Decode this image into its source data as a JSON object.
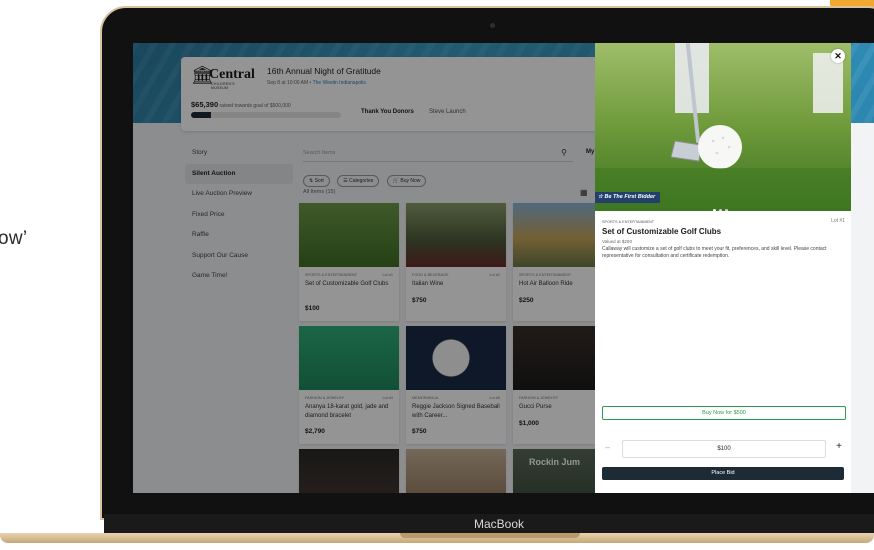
{
  "marketing": {
    "side_text": "ow’"
  },
  "device": {
    "label": "MacBook"
  },
  "event": {
    "org_name": "Central",
    "org_sub": "CHILDREN'S MUSEUM",
    "title": "16th Annual Night of Gratitude",
    "date": "Sep 8 at 10:00 AM • ",
    "venue": "The Westin Indianapolis",
    "raised_amount": "$65,390",
    "raised_text": "raised towards goal of $500,000",
    "progress_fraction": 0.13,
    "tabs": [
      "Thank You Donors",
      "Steve Launch"
    ]
  },
  "sidebar": {
    "items": [
      {
        "label": "Story"
      },
      {
        "label": "Silent Auction",
        "active": true
      },
      {
        "label": "Live Auction Preview"
      },
      {
        "label": "Fixed Price"
      },
      {
        "label": "Raffle"
      },
      {
        "label": "Support Our Cause"
      },
      {
        "label": "Game Time!"
      }
    ]
  },
  "toolbar": {
    "search_placeholder": "Search Items",
    "my_bids": "My",
    "chips": [
      "Sort",
      "Categories",
      "Buy Now"
    ],
    "all_items": "All Items (15)"
  },
  "items": [
    {
      "category": "SPORTS & ENTERTAINMENT",
      "lot": "Lot #1",
      "name": "Set of Customizable Golf Clubs",
      "price": "$100"
    },
    {
      "category": "FOOD & BEVERAGE",
      "lot": "Lot #2",
      "name": "Italian Wine",
      "price": "$750"
    },
    {
      "category": "SPORTS & ENTERTAINMENT",
      "lot": "",
      "name": "Hot Air Balloon Ride",
      "price": "$250"
    },
    {
      "category": "FASHION & JEWELRY",
      "lot": "Lot #4",
      "name": "Ananya 18-karat gold, jade and diamond bracelet",
      "price": "$2,790"
    },
    {
      "category": "MEMORABILIA",
      "lot": "Lot #5",
      "name": "Reggie Jackson Signed Baseball with Career...",
      "price": "$750"
    },
    {
      "category": "FASHION & JEWELRY",
      "lot": "",
      "name": "Gucci Purse",
      "price": "$1,000"
    },
    {
      "category": "",
      "lot": "",
      "name": "",
      "price": ""
    },
    {
      "category": "",
      "lot": "",
      "name": "",
      "price": ""
    },
    {
      "category": "",
      "lot": "Rockin Jum",
      "name": "",
      "price": ""
    }
  ],
  "modal": {
    "badge": "Be The First Bidder",
    "category": "SPORTS & ENTERTAINMENT",
    "lot": "Lot #1",
    "title": "Set of Customizable Golf Clubs",
    "valued": "Valued at $200",
    "description": "Callaway will customize a set of golf clubs to meet your fit, preferences, and skill level. Please contact representative for consultation and certificate redemption.",
    "buy_now": "Buy Now for $500",
    "bid_amount": "$100",
    "place_bid": "Place Bid",
    "close_icon": "close-icon",
    "image_dots": 3
  }
}
